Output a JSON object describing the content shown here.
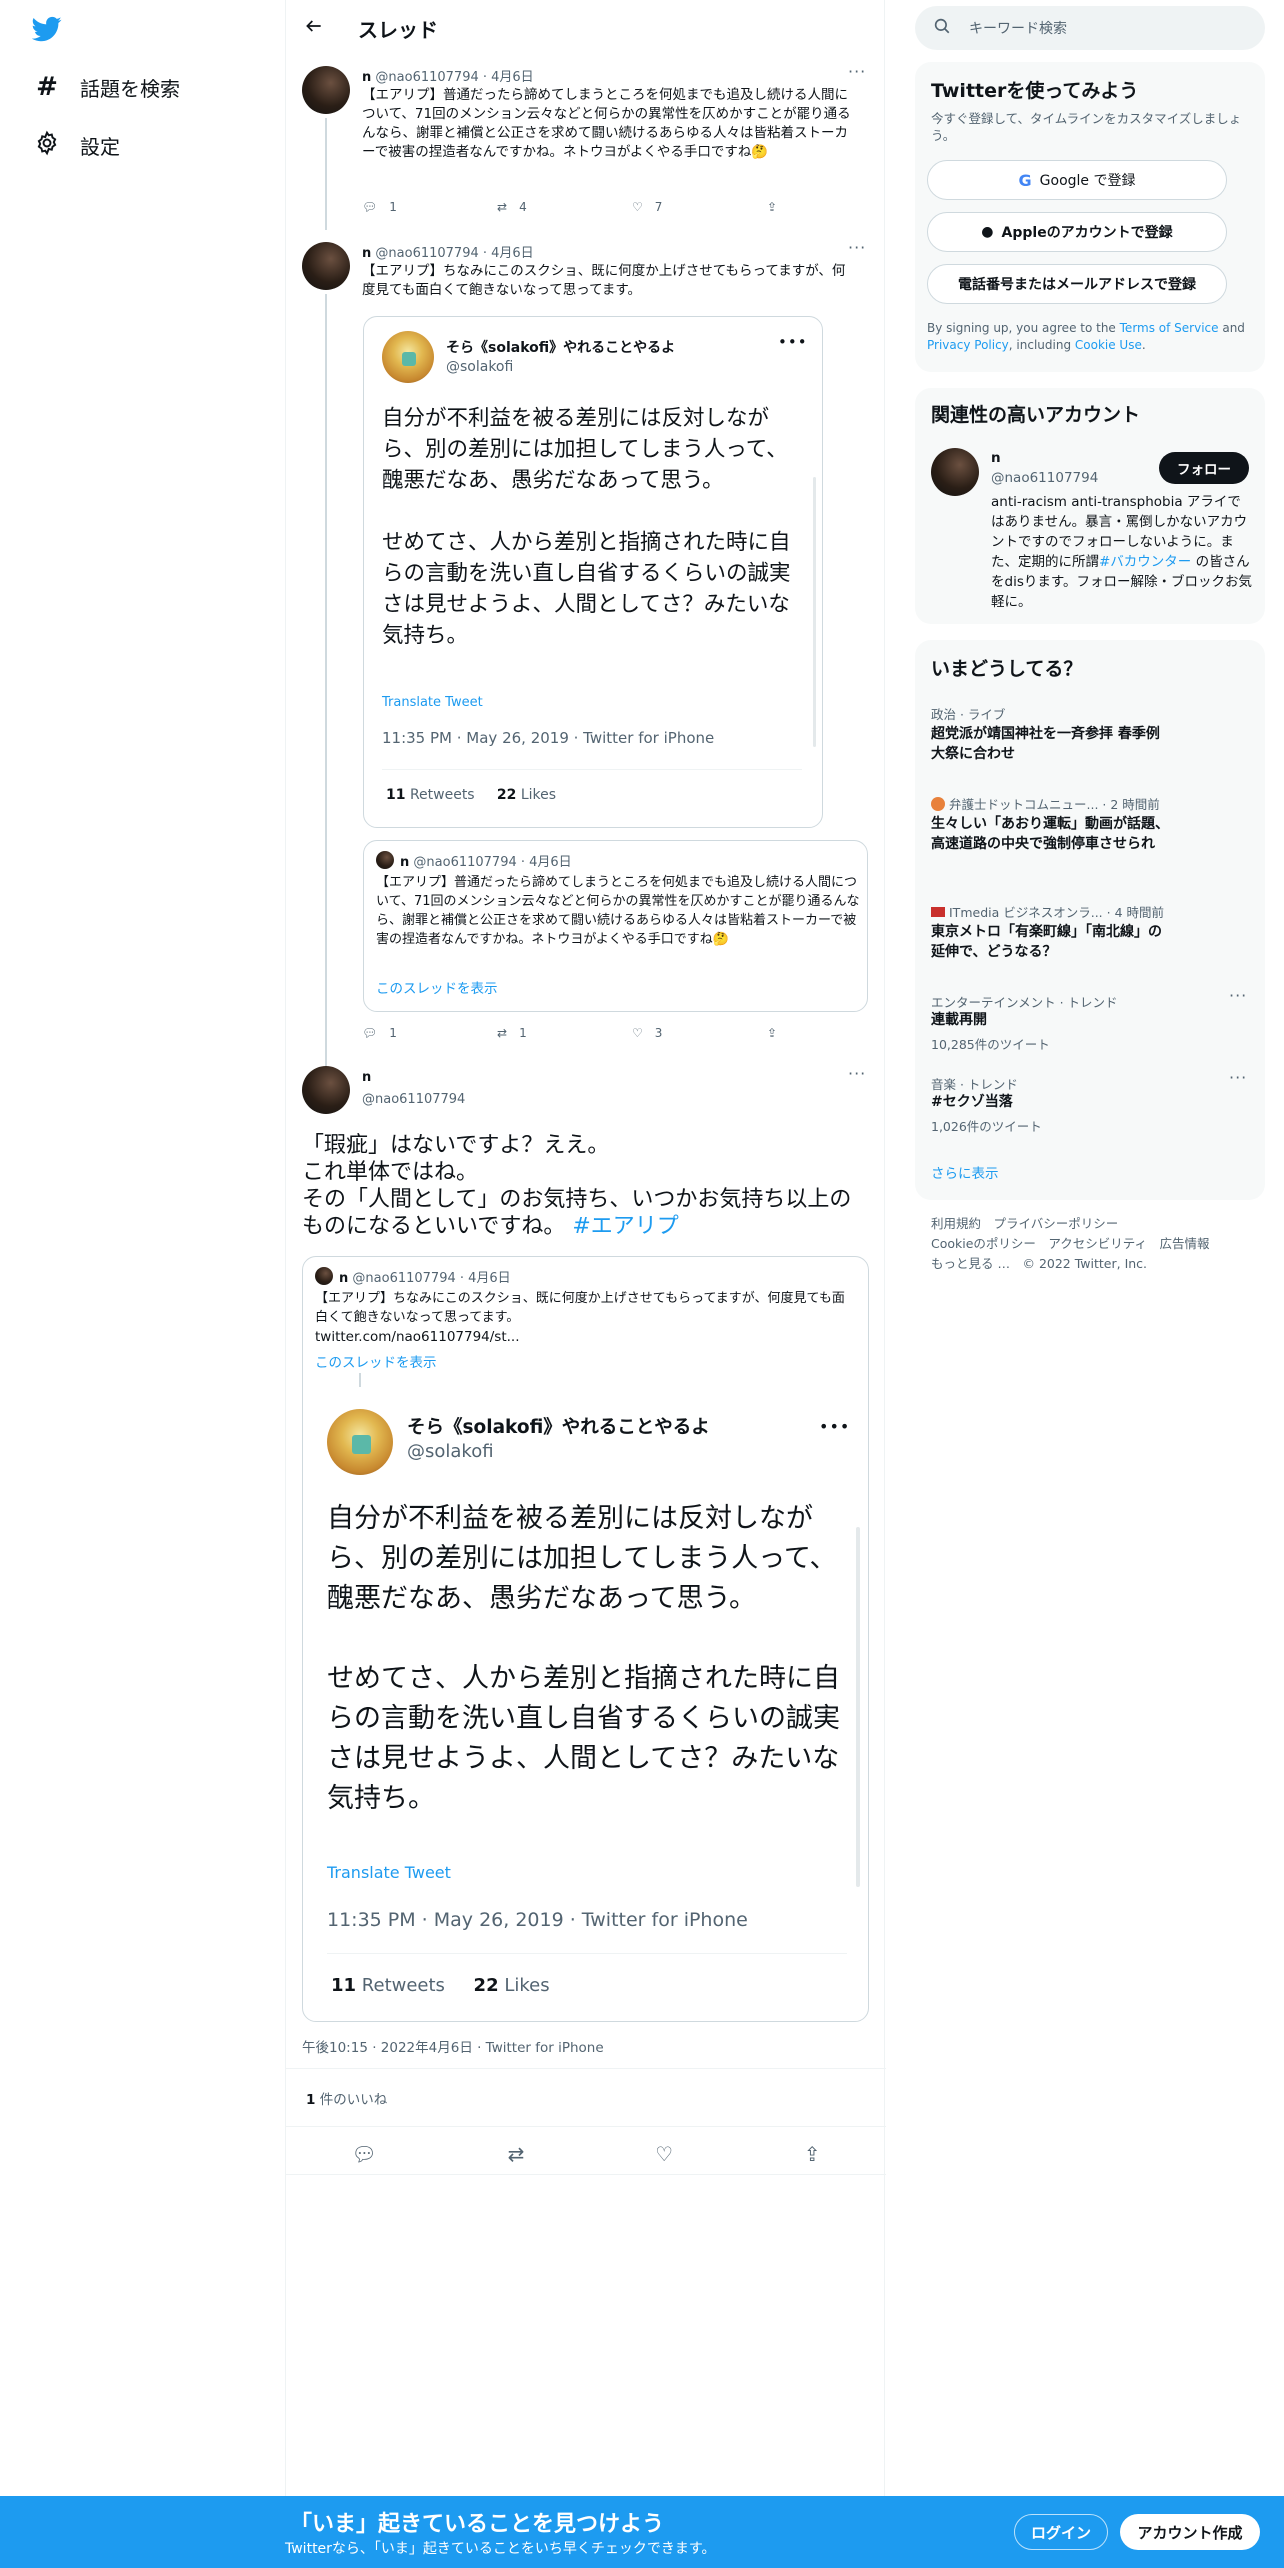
{
  "nav": {
    "explore_label": "話題を検索",
    "settings_label": "設定"
  },
  "header": {
    "title": "スレッド"
  },
  "tweet1": {
    "name": "n",
    "handle_date": "@nao61107794 · 4月6日",
    "text": "【エアリプ】普通だったら諦めてしまうところを何処までも追及し続ける人間について、71回のメンション云々などと何らかの異常性を仄めかすことが罷り通るんなら、謝罪と補償と公正さを求めて闘い続けるあらゆる人々は皆粘着ストーカーで被害の捏造者なんですかね。ネトウヨがよくやる手口ですね🤔",
    "replies": "1",
    "retweets": "4",
    "likes": "7"
  },
  "tweet2": {
    "name": "n",
    "handle_date": "@nao61107794 · 4月6日",
    "text": "【エアリプ】ちなみにこのスクショ、既に何度か上げさせてもらってますが、何度見ても面白くて飽きないなって思ってます。",
    "replies": "1",
    "retweets": "1",
    "likes": "3",
    "embed": {
      "name": "そら《solakofi》やれることやるよ",
      "handle": "@solakofi",
      "text": "自分が不利益を被る差別には反対しながら、別の差別には加担してしまう人って、醜悪だなあ、愚劣だなあって思う。\n\nせめてさ、人から差別と指摘された時に自らの言動を洗い直し自省するくらいの誠実さは見せようよ、人間としてさ？みたいな気持ち。",
      "translate": "Translate Tweet",
      "meta": "11:35 PM · May 26, 2019 · Twitter for iPhone",
      "retweets_num": "11",
      "retweets_label": "Retweets",
      "likes_num": "22",
      "likes_label": "Likes"
    },
    "quote": {
      "name": "n",
      "handle_date": "@nao61107794 · 4月6日",
      "text": "【エアリプ】普通だったら諦めてしまうところを何処までも追及し続ける人間について、71回のメンション云々などと何らかの異常性を仄めかすことが罷り通るんなら、謝罪と補償と公正さを求めて闘い続けるあらゆる人々は皆粘着ストーカーで被害の捏造者なんですかね。ネトウヨがよくやる手口ですね🤔",
      "show_thread": "このスレッドを表示"
    }
  },
  "main_tweet": {
    "name": "n",
    "handle": "@nao61107794",
    "text": "「瑕疵」はないですよ？ええ。\nこれ単体ではね。\nその「人間として」のお気持ち、いつかお気持ち以上のものになるといいですね。",
    "hashtag": "#エアリプ",
    "quote": {
      "name": "n",
      "handle_date": "@nao61107794 · 4月6日",
      "text": "【エアリプ】ちなみにこのスクショ、既に何度か上げさせてもらってますが、何度見ても面白くて飽きないなって思ってます。",
      "link": "twitter.com/nao61107794/st...",
      "show_thread": "このスレッドを表示"
    },
    "embed": {
      "name": "そら《solakofi》やれることやるよ",
      "handle": "@solakofi",
      "text": "自分が不利益を被る差別には反対しながら、別の差別には加担してしまう人って、醜悪だなあ、愚劣だなあって思う。\n\nせめてさ、人から差別と指摘された時に自らの言動を洗い直し自省するくらいの誠実さは見せようよ、人間としてさ？みたいな気持ち。",
      "translate": "Translate Tweet",
      "meta": "11:35 PM · May 26, 2019 · Twitter for iPhone",
      "retweets_num": "11",
      "retweets_label": "Retweets",
      "likes_num": "22",
      "likes_label": "Likes"
    },
    "timestamp": "午後10:15 · 2022年4月6日 · Twitter for iPhone",
    "likes_num": "1",
    "likes_label": "件のいいね"
  },
  "right": {
    "search_placeholder": "キーワード検索",
    "signup": {
      "title": "Twitterを使ってみよう",
      "subtitle": "今すぐ登録して、タイムラインをカスタマイズしましょう。",
      "google": "Google で登録",
      "apple": "Appleのアカウントで登録",
      "phone": "電話番号またはメールアドレスで登録",
      "terms_a": "By signing up, you agree to the ",
      "terms_tos": "Terms of Service",
      "terms_b": " and ",
      "terms_pp": "Privacy Policy",
      "terms_c": ", including ",
      "terms_cu": "Cookie Use",
      "terms_d": "."
    },
    "related": {
      "title": "関連性の高いアカウント",
      "name": "n",
      "handle": "@nao61107794",
      "follow": "フォロー",
      "bio_a": "anti-racism anti-transphobia アライではありません。暴言・罵倒しかないアカウントですのでフォローしないように。また、定期的に所謂",
      "bio_link": "#バカウンター",
      "bio_b": "の皆さんをdisります。フォロー解除・ブロックお気軽に。"
    },
    "trends": {
      "title": "いまどうしてる？",
      "items": [
        {
          "cat": "政治 · ライブ",
          "name": "超党派が靖国神社を一斉参拝 春季例大祭に合わせ"
        },
        {
          "cat": "弁護士ドットコムニュー... · 2 時間前",
          "name": "生々しい「あおり運転」動画が話題、高速道路の中央で強制停車させられ"
        },
        {
          "cat": "ITmedia ビジネスオンラ... · 4 時間前",
          "name": "東京メトロ「有楽町線」「南北線」の延伸で、どうなる？"
        },
        {
          "cat": "エンターテインメント · トレンド",
          "name": "連載再開",
          "count": "10,285件のツイート"
        },
        {
          "cat": "音楽 · トレンド",
          "name": "#セクゾ当落",
          "count": "1,026件のツイート"
        }
      ],
      "more": "さらに表示"
    },
    "footer": {
      "line1": "利用規約　プライバシーポリシー",
      "line2": "Cookieのポリシー　アクセシビリティ　広告情報",
      "line3": "もっと見る …　© 2022 Twitter, Inc."
    }
  },
  "banner": {
    "title": "「いま」起きていることを見つけよう",
    "subtitle": "Twitterなら、「いま」起きていることをいち早くチェックできます。",
    "login": "ログイン",
    "signup": "アカウント作成"
  },
  "colors": {
    "accent": "#1d9bf0",
    "text": "#0f1419",
    "secondary": "#536471"
  }
}
